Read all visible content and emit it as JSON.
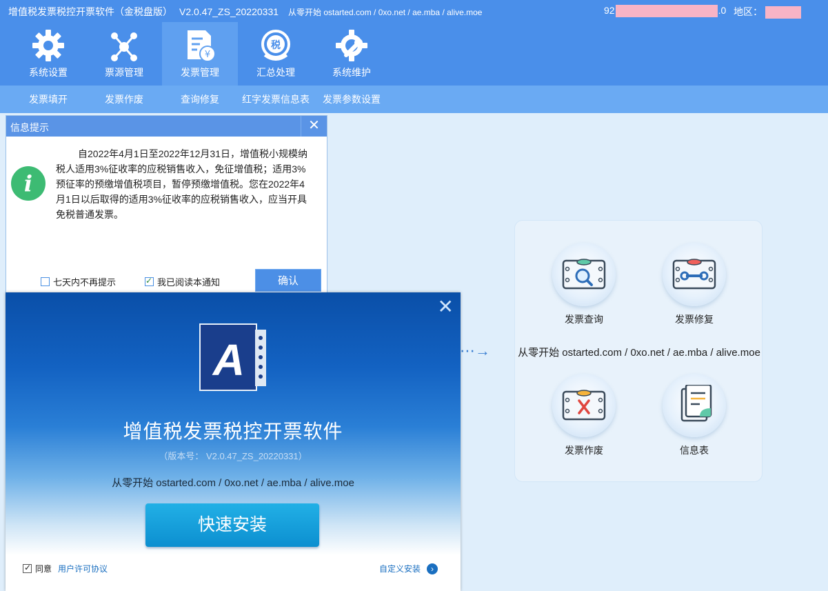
{
  "window": {
    "title": "增值税发票税控开票软件（金税盘版）",
    "version": "V2.0.47_ZS_20220331",
    "subtitle": "从零开始 ostarted.com / 0xo.net / ae.mba / alive.moe",
    "tax_id_prefix": "92",
    "tax_id_suffix": ".0",
    "region_label": "地区："
  },
  "nav": {
    "items": [
      {
        "label": "系统设置",
        "icon": "gear-icon"
      },
      {
        "label": "票源管理",
        "icon": "network-icon"
      },
      {
        "label": "发票管理",
        "icon": "invoice-icon",
        "active": true
      },
      {
        "label": "汇总处理",
        "icon": "tax-summary-icon"
      },
      {
        "label": "系统维护",
        "icon": "wrench-gear-icon"
      }
    ],
    "sub_items": [
      {
        "label": "发票填开"
      },
      {
        "label": "发票作废"
      },
      {
        "label": "查询修复"
      },
      {
        "label": "红字发票信息表"
      },
      {
        "label": "发票参数设置"
      }
    ]
  },
  "info_dialog": {
    "title": "信息提示",
    "close": "✕",
    "icon_glyph": "i",
    "message": "自2022年4月1日至2022年12月31日，增值税小规模纳税人适用3%征收率的应税销售收入，免征增值税；适用3%预征率的预缴增值税项目，暂停预缴增值税。您在2022年4月1日以后取得的适用3%征收率的应税销售收入，应当开具免税普通发票。",
    "checkbox_7days": "七天内不再提示",
    "checkbox_read": "我已阅读本通知",
    "confirm_label": "确认"
  },
  "panel": {
    "arrow": "⋯→",
    "items": [
      {
        "label": "发票查询",
        "icon": "invoice-search-icon"
      },
      {
        "label": "发票修复",
        "icon": "invoice-repair-icon"
      },
      {
        "label": "发票作废",
        "icon": "invoice-void-icon"
      },
      {
        "label": "信息表",
        "icon": "info-sheet-icon"
      }
    ],
    "url_text": "从零开始 ostarted.com / 0xo.net / ae.mba / alive.moe"
  },
  "installer": {
    "close": "✕",
    "logo_letter": "A",
    "title": "增值税发票税控开票软件",
    "version_text": "（版本号： V2.0.47_ZS_20220331）",
    "url_text": "从零开始 ostarted.com / 0xo.net / ae.mba / alive.moe",
    "install_label": "快速安装",
    "agree_label": "同意",
    "license_link": "用户许可协议",
    "custom_label": "自定义安装",
    "custom_glyph": "›"
  },
  "colors": {
    "header_bg": "#4a8fea",
    "subnav_bg": "#6aaaf3",
    "redaction": "#f8b4c6",
    "install_button": "#0c8fd0"
  }
}
